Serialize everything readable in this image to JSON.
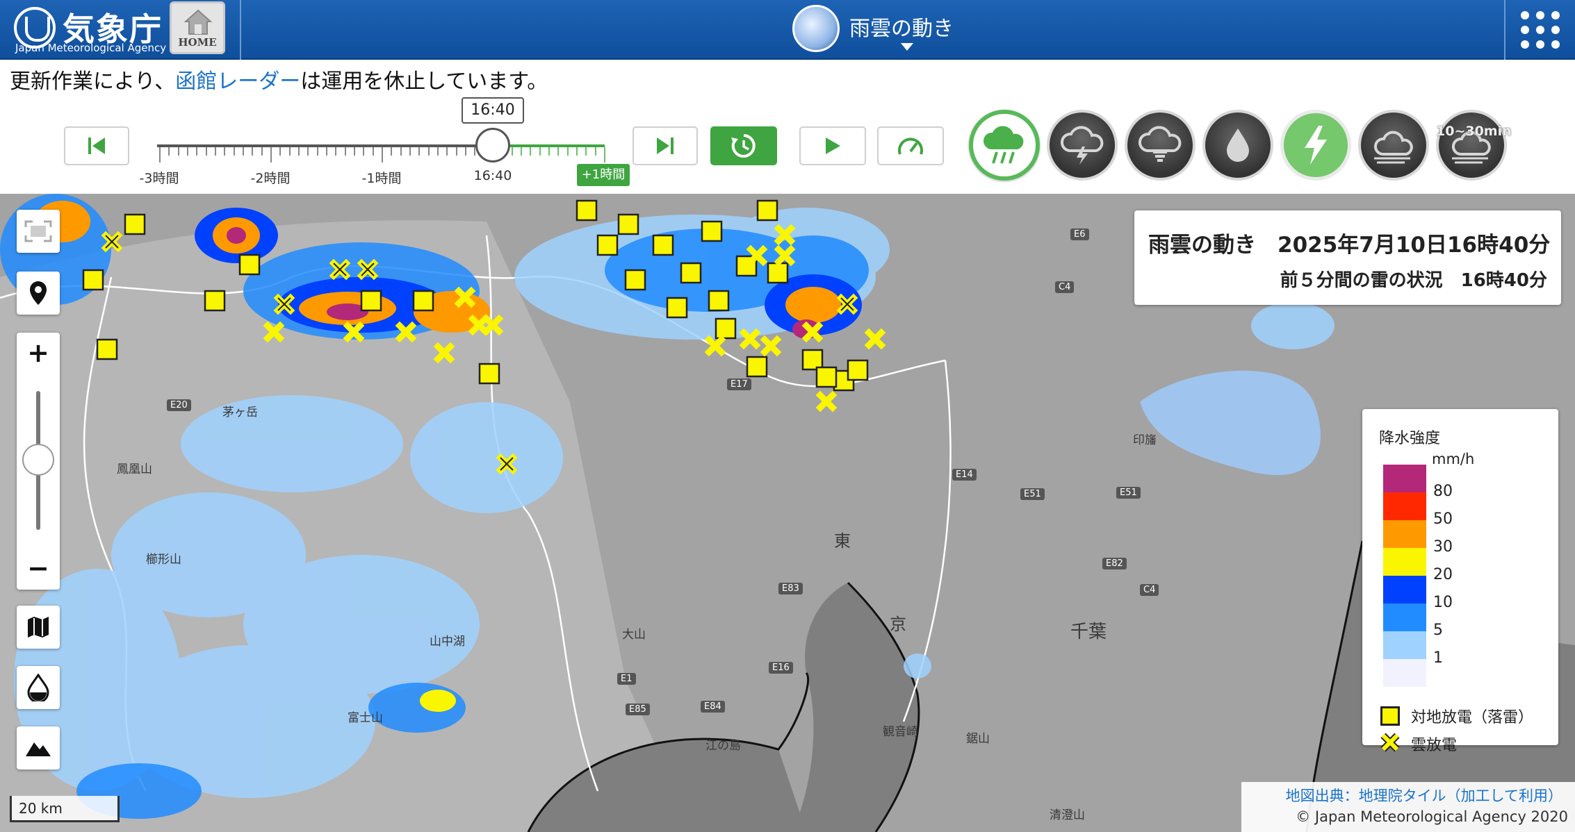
{
  "header": {
    "org_name": "気象庁",
    "org_sub": "Japan Meteorological Agency",
    "home_label": "HOME",
    "app_title": "雨雲の動き"
  },
  "notice": {
    "prefix": "更新作業により、",
    "link": "函館レーダー",
    "suffix": "は運用を休止しています。"
  },
  "timeline": {
    "current": "16:40",
    "labels": [
      "-3時間",
      "-2時間",
      "-1時間",
      "16:40"
    ],
    "future_label": "+1時間",
    "position_fraction": 0.75
  },
  "modes": {
    "active": "雨雲",
    "items": [
      {
        "name": "rain-cloud",
        "state": "active"
      },
      {
        "name": "thunder-cloud",
        "state": "off"
      },
      {
        "name": "tornado-cloud",
        "state": "off"
      },
      {
        "name": "rain-drop",
        "state": "off"
      },
      {
        "name": "lightning",
        "state": "highlight"
      },
      {
        "name": "cloud-motion",
        "state": "off"
      },
      {
        "name": "cloud-10-30",
        "state": "off"
      }
    ],
    "label_10_30": "10~30min"
  },
  "info_box": {
    "title": "雨雲の動き　2025年7月10日16時40分",
    "sub": "前５分間の雷の状況　16時40分"
  },
  "legend": {
    "title": "降水強度",
    "unit": "mm/h",
    "levels": [
      {
        "label": "80",
        "color": "#b4287a"
      },
      {
        "label": "50",
        "color": "#ff2800"
      },
      {
        "label": "30",
        "color": "#ff9900"
      },
      {
        "label": "20",
        "color": "#faf500"
      },
      {
        "label": "10",
        "color": "#0041ff"
      },
      {
        "label": "5",
        "color": "#218cff"
      },
      {
        "label": "1",
        "color": "#a0d2ff"
      },
      {
        "label": "",
        "color": "#f2f2ff"
      }
    ],
    "marks": [
      {
        "label": "対地放電（落雷）"
      },
      {
        "label": "雲放電"
      }
    ]
  },
  "map": {
    "scale_label": "20 km",
    "attribution": "地図出典：地理院タイル（加工して利用）",
    "copyright": "© Japan Meteorological Agency 2020",
    "places": [
      "茅ヶ岳",
      "鳳凰山",
      "櫛形山",
      "山中湖",
      "富士山",
      "大山",
      "江の島",
      "観音崎",
      "千葉",
      "東",
      "京",
      "鋸山",
      "清澄山",
      "印旛"
    ],
    "roads": [
      "E20",
      "E17",
      "E6",
      "C4",
      "E14",
      "E51",
      "E82",
      "E83",
      "E16",
      "E84",
      "E85",
      "E1",
      "C4",
      "E51"
    ]
  }
}
